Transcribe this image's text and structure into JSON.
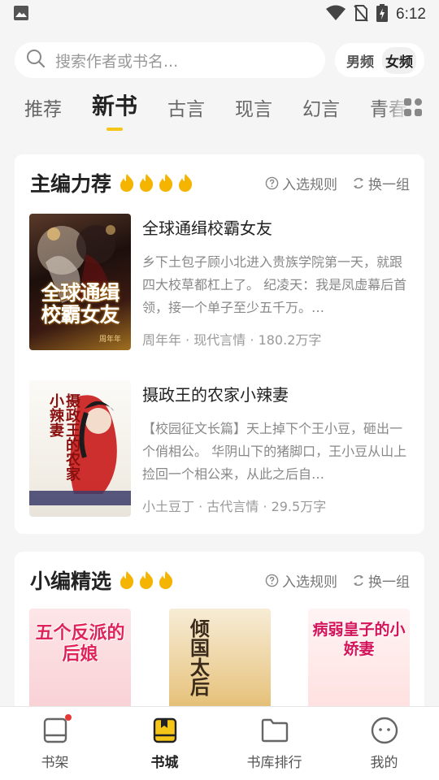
{
  "status_bar": {
    "time": "6:12",
    "icons": [
      "image-icon",
      "wifi-icon",
      "no-sim-icon",
      "battery-charging-icon"
    ]
  },
  "search": {
    "placeholder": "搜索作者或书名...",
    "gender_male": "男频",
    "gender_female": "女频",
    "gender_selected": "女频"
  },
  "tabs": [
    {
      "label": "推荐"
    },
    {
      "label": "新书"
    },
    {
      "label": "古言"
    },
    {
      "label": "现言"
    },
    {
      "label": "幻言"
    },
    {
      "label": "青春"
    }
  ],
  "active_tab": "新书",
  "section_editor": {
    "title": "主编力荐",
    "flame_count": 4,
    "rules_label": "入选规则",
    "refresh_label": "换一组",
    "books": [
      {
        "title": "全球通缉校霸女友",
        "desc": "乡下土包子顾小北进入贵族学院第一天，就跟四大校草都杠上了。 纪凌天：我是凤虚幕后首领，接一个单子至少五千万。…",
        "author": "周年年",
        "category": "现代言情",
        "words": "180.2万字",
        "cover_title": "全球通缉校霸女友",
        "cover_author": "周年年"
      },
      {
        "title": "摄政王的农家小辣妻",
        "desc": "【校园征文长篇】天上掉下个王小豆，砸出一个俏相公。 华阴山下的猪脚口，王小豆从山上捡回一个相公来，从此之后自…",
        "author": "小土豆丁",
        "category": "古代言情",
        "words": "29.5万字",
        "cover_title": "摄政王的农家小辣妻"
      }
    ]
  },
  "section_picks": {
    "title": "小编精选",
    "flame_count": 3,
    "rules_label": "入选规则",
    "refresh_label": "换一组",
    "covers": [
      {
        "cover_title": "五个反派的后娘"
      },
      {
        "cover_title": "倾国太后"
      },
      {
        "cover_title": "病弱皇子的小娇妻"
      }
    ]
  },
  "bottom_nav": [
    {
      "label": "书架",
      "icon": "bookshelf-icon"
    },
    {
      "label": "书城",
      "icon": "bookstore-icon"
    },
    {
      "label": "书库排行",
      "icon": "folder-icon"
    },
    {
      "label": "我的",
      "icon": "profile-icon"
    }
  ],
  "colors": {
    "accent": "#f5c518",
    "flame": "#f5b400",
    "background": "#f5f5f6",
    "badge": "#e53935"
  }
}
